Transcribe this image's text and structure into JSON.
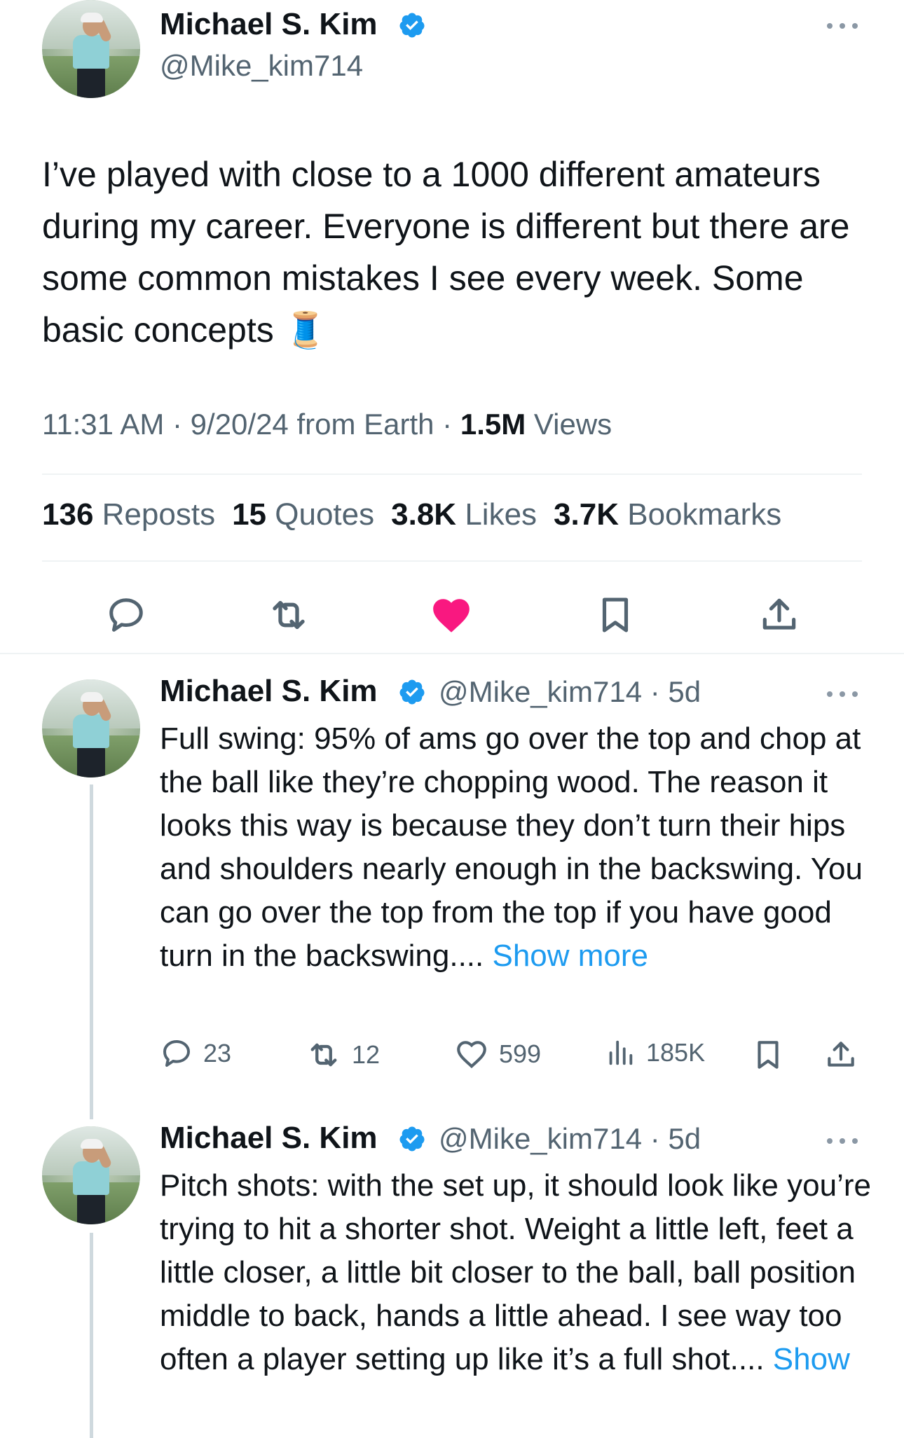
{
  "main_tweet": {
    "author_name": "Michael S. Kim",
    "handle": "@Mike_kim714",
    "text": "I’ve played with close to a 1000 different amateurs during my career. Everyone is different but there are some common mistakes I see every week. Some basic concepts 🧵",
    "time": "11:31 AM · 9/20/24 from Earth · ",
    "views_count": "1.5M",
    "views_label": " Views",
    "stats": {
      "reposts_count": "136",
      "reposts_label": "Reposts",
      "quotes_count": "15",
      "quotes_label": "Quotes",
      "likes_count": "3.8K",
      "likes_label": "Likes",
      "bookmarks_count": "3.7K",
      "bookmarks_label": "Bookmarks"
    },
    "liked": true
  },
  "replies": [
    {
      "author_name": "Michael S. Kim",
      "handle_time": "@Mike_kim714 · 5d",
      "text": "Full swing: 95% of ams go over the top and chop at the ball like they’re chopping wood. The reason it looks this way is because they don’t turn their hips and shoulders nearly enough in the backswing. You can go over the top from the top if you have good turn in the backswing.... ",
      "show_more": "Show more",
      "replies_count": "23",
      "reposts_count": "12",
      "likes_count": "599",
      "views_count": "185K"
    },
    {
      "author_name": "Michael S. Kim",
      "handle_time": "@Mike_kim714 · 5d",
      "text": "Pitch shots: with the set up, it should look like you’re trying to hit a shorter shot. Weight a little left, feet a little closer, a little bit closer to the ball, ball position middle to back, hands a little ahead. I see way too often a player setting up like it’s a full shot.... ",
      "show_more": "Show"
    }
  ],
  "colors": {
    "accent": "#1d9bf0",
    "like": "#f91880",
    "icon": "#536471",
    "text": "#0f1419"
  }
}
